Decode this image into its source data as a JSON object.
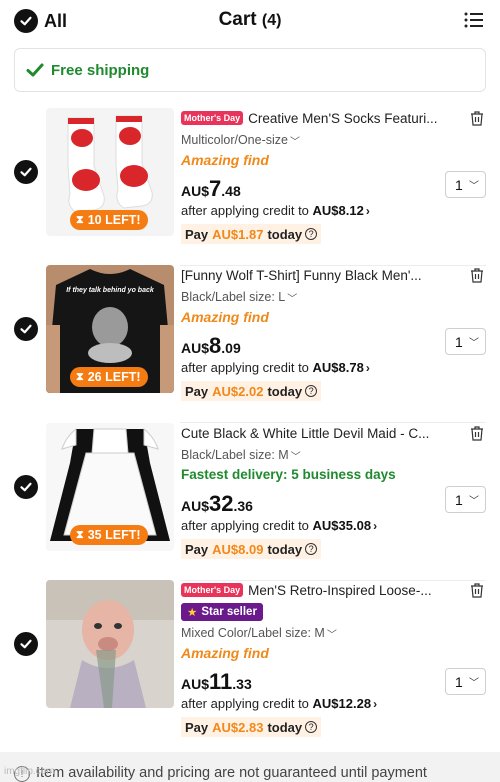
{
  "header": {
    "select_all_label": "All",
    "title": "Cart",
    "count": "(4)"
  },
  "shipping": {
    "label": "Free shipping"
  },
  "items": [
    {
      "tag": "Mother's Day",
      "title": "Creative Men'S Socks Featuri...",
      "variant": "Multicolor/One-size",
      "tagline": "Amazing find",
      "currency": "AU$",
      "price_big": "7",
      "price_small": ".48",
      "credit_text": "after applying credit to",
      "credit_amount": "AU$8.12",
      "pay_label": "Pay",
      "pay_amount": "AU$1.87",
      "pay_when": "today",
      "stock_badge": "10 LEFT!",
      "qty": "1"
    },
    {
      "tag": "",
      "title": "[Funny Wolf T-Shirt] Funny Black Men'...",
      "variant": "Black/Label size: L",
      "tagline": "Amazing find",
      "currency": "AU$",
      "price_big": "8",
      "price_small": ".09",
      "credit_text": "after applying credit to",
      "credit_amount": "AU$8.78",
      "pay_label": "Pay",
      "pay_amount": "AU$2.02",
      "pay_when": "today",
      "stock_badge": "26 LEFT!",
      "shirt_text": "If they talk behind yo back",
      "qty": "1"
    },
    {
      "tag": "",
      "title": "Cute Black & White Little Devil Maid - C...",
      "variant": "Black/Label size: M",
      "tagline": "Fastest delivery: 5 business days",
      "currency": "AU$",
      "price_big": "32",
      "price_small": ".36",
      "credit_text": "after applying credit to",
      "credit_amount": "AU$35.08",
      "pay_label": "Pay",
      "pay_amount": "AU$8.09",
      "pay_when": "today",
      "stock_badge": "35 LEFT!",
      "qty": "1"
    },
    {
      "tag": "Mother's Day",
      "title": "Men'S Retro-Inspired Loose-...",
      "star_seller": "Star seller",
      "variant": "Mixed Color/Label size: M",
      "tagline": "Amazing find",
      "currency": "AU$",
      "price_big": "11",
      "price_small": ".33",
      "credit_text": "after applying credit to",
      "credit_amount": "AU$12.28",
      "pay_label": "Pay",
      "pay_amount": "AU$2.83",
      "pay_when": "today",
      "qty": "1"
    }
  ],
  "footer": {
    "text": "Item availability and pricing are not guaranteed until payment"
  },
  "watermark": "imgflip.com",
  "colors": {
    "accent_orange": "#f0891a",
    "green": "#1f8a2e",
    "tag_pink": "#e8345a",
    "star_purple": "#6a1a8a"
  }
}
